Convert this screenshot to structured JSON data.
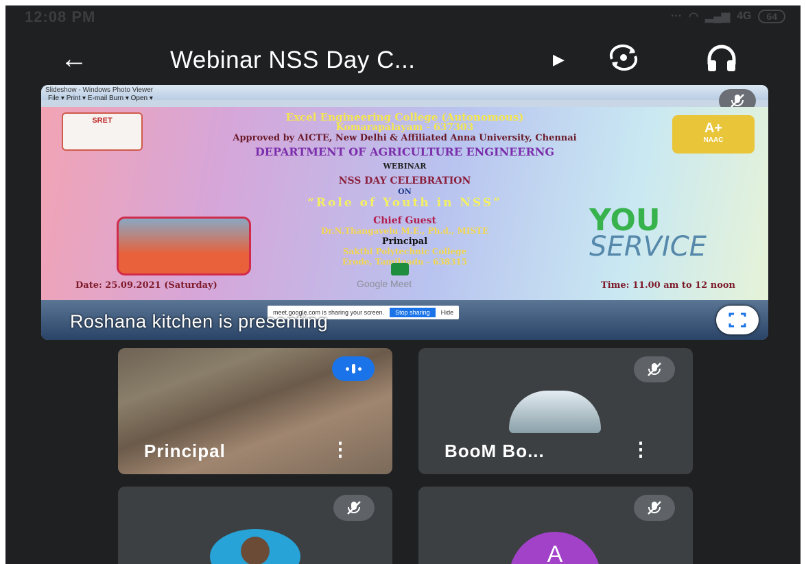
{
  "status_bar": {
    "time": "12:08 PM",
    "signal": "4G",
    "battery": "64"
  },
  "header": {
    "title": "Webinar NSS Day C...",
    "back_icon": "arrow-left-icon",
    "switch_camera_icon": "camera-switch-icon",
    "audio_icon": "headphones-icon"
  },
  "presentation": {
    "window_title": "Slideshow - Windows Photo Viewer",
    "menu": "File  ▾  Print  ▾  E-mail   Burn  ▾  Open  ▾",
    "college": "Excel Engineering College (Autonomous)",
    "place": "Komarapalayam - 637303",
    "approved": "Approved by AICTE, New Delhi & Affiliated Anna University, Chennai",
    "department": "DEPARTMENT OF AGRICULTURE ENGINEERNG",
    "webinar": "WEBINAR",
    "event": "NSS DAY CELEBRATION",
    "on": "ON",
    "topic": "“Role of Youth in NSS”",
    "chief_guest_label": "Chief Guest",
    "guest_name": "Dr.N.Thangavelu M.E., Ph.d., MISTE",
    "guest_role": "Principal",
    "guest_college": "Sakthi Polytechnic College",
    "guest_place": "Erode, Tamilnadu - 638315",
    "date": "Date: 25.09.2021 (Saturday)",
    "meet": "Google Meet",
    "time": "Time: 11.00 am to 12 noon",
    "logo_left_text": "SRET",
    "logo_right_text": "A+",
    "logo_right_sub": "NAAC",
    "you_service_1": "YOU",
    "you_service_2": "SERVICE",
    "sharing_text": "meet.google.com is sharing your screen.",
    "stop_sharing": "Stop sharing",
    "hide": "Hide",
    "presenting": "Roshana kitchen is presenting"
  },
  "participants": [
    {
      "name": "Principal",
      "speaking": true
    },
    {
      "name": "BooM Bo...",
      "muted": true
    },
    {
      "name": "",
      "muted": true
    },
    {
      "name": "",
      "initial": "A",
      "muted": true,
      "color": "#a142c9"
    }
  ]
}
